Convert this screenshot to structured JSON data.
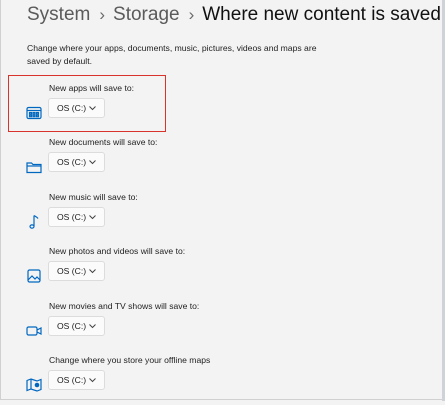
{
  "breadcrumb": {
    "items": [
      "System",
      "Storage"
    ],
    "current": "Where new content is saved",
    "separator": "›"
  },
  "description": "Change where your apps, documents, music, pictures, videos and maps are saved by default.",
  "settings": [
    {
      "label": "New apps will save to:",
      "value": "OS (C:)",
      "icon": "app-window-icon"
    },
    {
      "label": "New documents will save to:",
      "value": "OS (C:)",
      "icon": "folder-icon"
    },
    {
      "label": "New music will save to:",
      "value": "OS (C:)",
      "icon": "music-note-icon"
    },
    {
      "label": "New photos and videos will save to:",
      "value": "OS (C:)",
      "icon": "photo-icon"
    },
    {
      "label": "New movies and TV shows will save to:",
      "value": "OS (C:)",
      "icon": "video-camera-icon"
    },
    {
      "label": "Change where you store your offline maps",
      "value": "OS (C:)",
      "icon": "map-icon"
    }
  ],
  "colors": {
    "accent": "#0067c0",
    "highlight_border": "#d9342b",
    "background": "#f3f3f3"
  }
}
